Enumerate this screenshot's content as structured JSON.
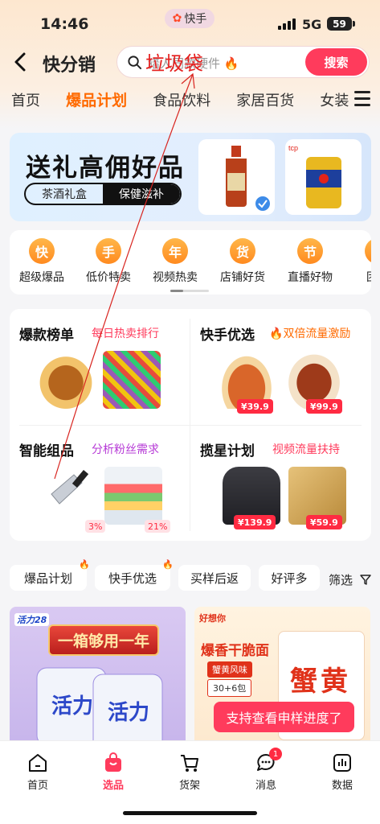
{
  "status_bar": {
    "time": "14:46",
    "app_pill": "快手",
    "network": "5G",
    "battery": "59"
  },
  "header": {
    "title": "快分销",
    "search_placeholder": "猎人同款硬件",
    "search_fire": "🔥",
    "search_overlay_text": "垃圾袋",
    "search_button": "搜索"
  },
  "tabs": [
    {
      "label": "首页",
      "active": false
    },
    {
      "label": "爆品计划",
      "active": true
    },
    {
      "label": "食品饮料",
      "active": false
    },
    {
      "label": "家居百货",
      "active": false
    },
    {
      "label": "女装",
      "active": false
    }
  ],
  "banner": {
    "title": "送礼高佣好品",
    "tag_left": "茶酒礼盒",
    "tag_right": "保健滋补"
  },
  "quick_entries": [
    {
      "glyph": "快",
      "label": "超级爆品"
    },
    {
      "glyph": "手",
      "label": "低价特卖"
    },
    {
      "glyph": "年",
      "label": "视频热卖"
    },
    {
      "glyph": "货",
      "label": "店铺好货"
    },
    {
      "glyph": "节",
      "label": "直播好物"
    },
    {
      "glyph": "团",
      "label": "团长"
    }
  ],
  "promo": {
    "top_left": {
      "title": "爆款榜单",
      "subtitle": "每日热卖排行"
    },
    "top_right": {
      "title": "快手优选",
      "subtitle": "双倍流量激励",
      "prices": [
        "¥39.9",
        "¥99.9"
      ]
    },
    "bottom_left": {
      "title": "智能组品",
      "subtitle": "分析粉丝需求",
      "percents": [
        "3%",
        "21%"
      ]
    },
    "bottom_right": {
      "title": "揽星计划",
      "subtitle": "视频流量扶持",
      "prices": [
        "¥139.9",
        "¥59.9"
      ]
    }
  },
  "filters": {
    "chips": [
      "爆品计划",
      "快手优选",
      "买样后返",
      "好评多"
    ],
    "filter_label": "筛选"
  },
  "products": {
    "left": {
      "corner": "活力28",
      "headline": "一箱够用一年"
    },
    "right": {
      "brand": "好想你",
      "headline": "爆香干脆面",
      "badge1": "蟹黄风味",
      "badge2": "30+6包"
    }
  },
  "toast": "支持查看申样进度了",
  "bottom_nav": [
    {
      "label": "首页",
      "icon": "home-icon",
      "active": false
    },
    {
      "label": "选品",
      "icon": "shopping-bag-icon",
      "active": true
    },
    {
      "label": "货架",
      "icon": "cart-icon",
      "active": false
    },
    {
      "label": "消息",
      "icon": "message-icon",
      "active": false,
      "badge": "1"
    },
    {
      "label": "数据",
      "icon": "data-chart-icon",
      "active": false
    }
  ],
  "colors": {
    "accent": "#ff3b5c",
    "tab_active": "#ff6a00",
    "price": "#ff2b42",
    "annotation": "#e5201f"
  }
}
